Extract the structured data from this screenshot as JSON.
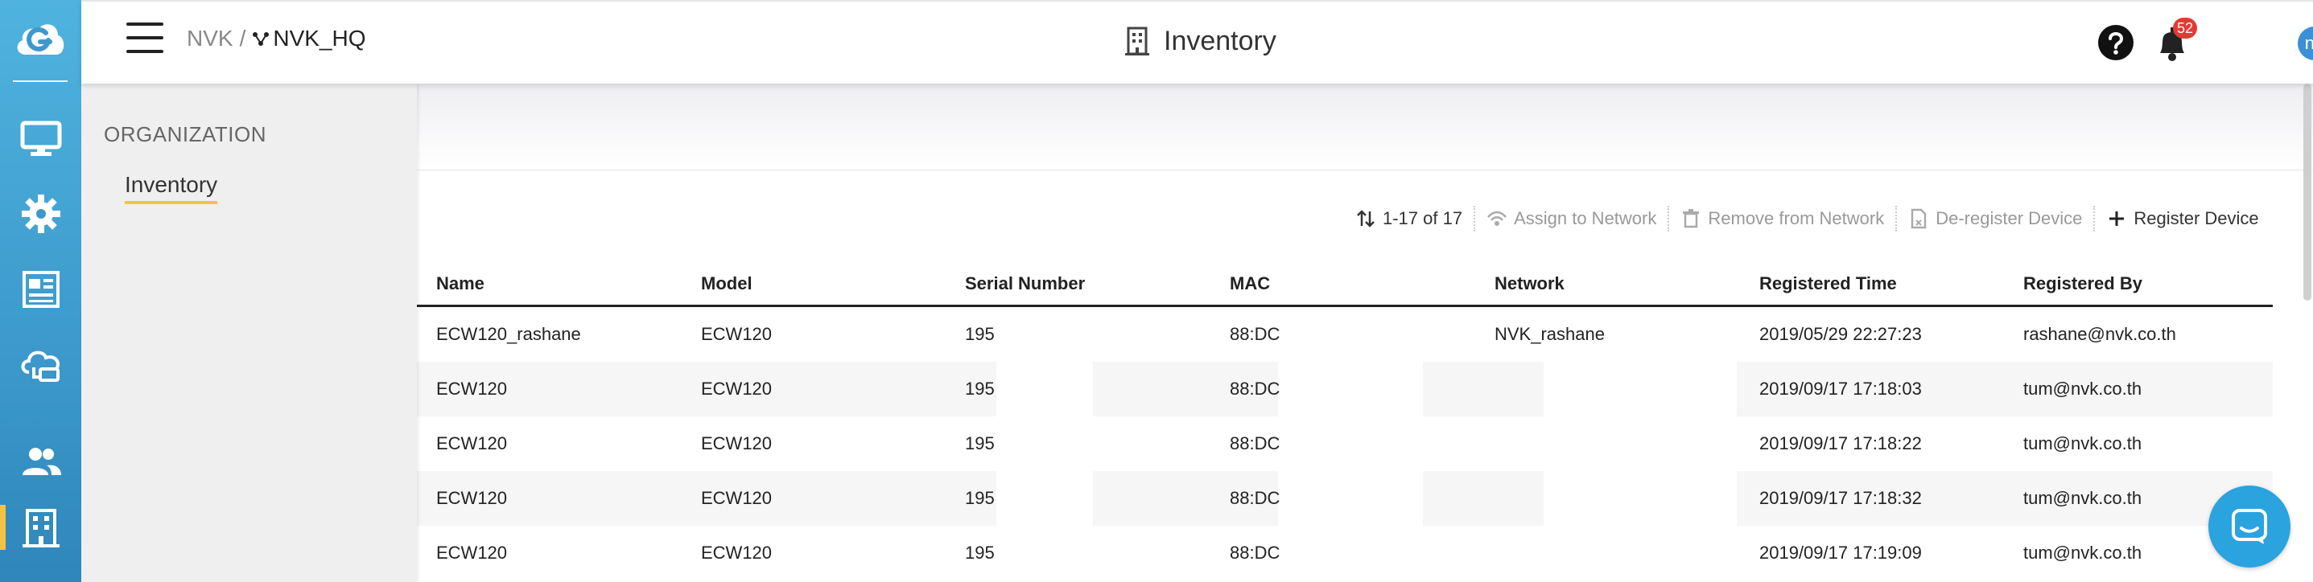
{
  "breadcrumb": {
    "org": "NVK",
    "separator": "/",
    "network": "NVK_HQ"
  },
  "header": {
    "title": "Inventory",
    "notifications_count": "52",
    "avatar_initials": "nu"
  },
  "menu": {
    "section": "ORGANIZATION",
    "item": "Inventory"
  },
  "rail": {
    "items": [
      "monitor-icon",
      "gear-icon",
      "report-icon",
      "cloud-sync-icon",
      "users-icon",
      "building-icon"
    ],
    "active": "building-icon",
    "accent": "#f6c243"
  },
  "toolbar": {
    "range": "1-17 of 17",
    "assign": "Assign to Network",
    "remove": "Remove from Network",
    "deregister": "De-register Device",
    "register": "Register Device"
  },
  "table": {
    "columns": [
      "Name",
      "Model",
      "Serial Number",
      "MAC",
      "Network",
      "Registered Time",
      "Registered By"
    ],
    "rows": [
      [
        "ECW120_rashane",
        "ECW120",
        "195",
        "88:DC",
        "NVK_rashane",
        "2019/05/29 22:27:23",
        "rashane@nvk.co.th"
      ],
      [
        "ECW120",
        "ECW120",
        "195",
        "88:DC",
        "",
        "2019/09/17 17:18:03",
        "tum@nvk.co.th"
      ],
      [
        "ECW120",
        "ECW120",
        "195",
        "88:DC",
        "",
        "2019/09/17 17:18:22",
        "tum@nvk.co.th"
      ],
      [
        "ECW120",
        "ECW120",
        "195",
        "88:DC",
        "",
        "2019/09/17 17:18:32",
        "tum@nvk.co.th"
      ],
      [
        "ECW120",
        "ECW120",
        "195",
        "88:DC",
        "",
        "2019/09/17 17:19:09",
        "tum@nvk.co.th"
      ]
    ]
  },
  "colors": {
    "brand": "#3d99cc",
    "badge": "#e53935",
    "chat": "#2aa3df"
  }
}
